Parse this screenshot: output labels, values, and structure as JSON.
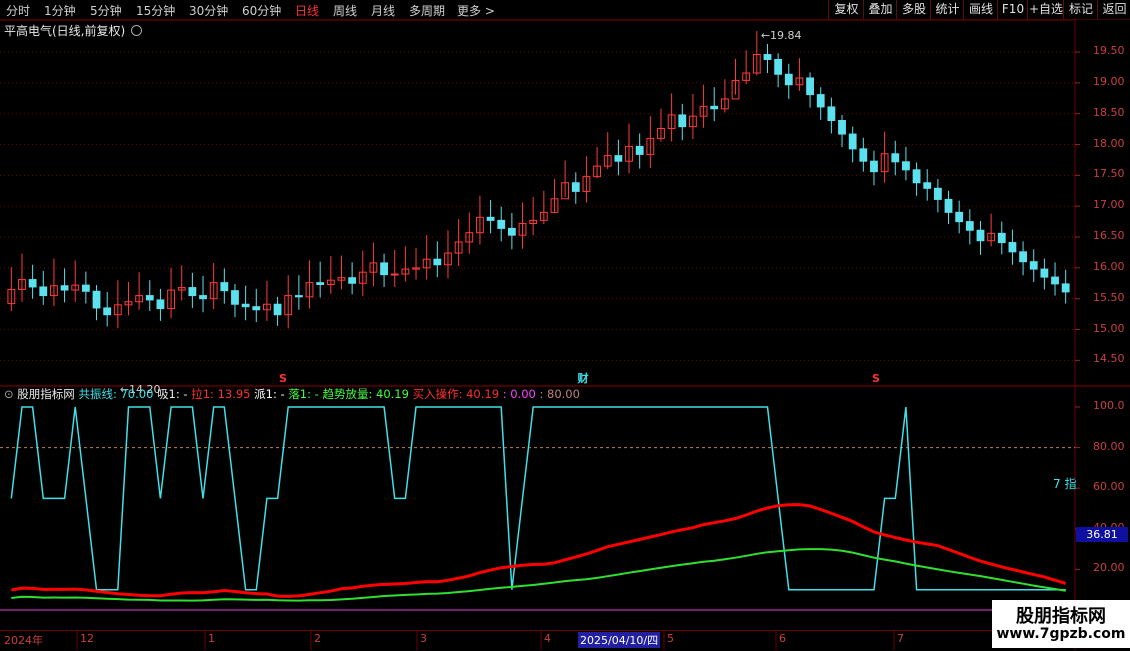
{
  "toolbar": {
    "timeframes": [
      "分时",
      "1分钟",
      "5分钟",
      "15分钟",
      "30分钟",
      "60分钟",
      "日线",
      "周线",
      "月线",
      "多周期",
      "更多 >"
    ],
    "active_timeframe": "日线",
    "right_buttons": [
      "复权",
      "叠加",
      "多股",
      "统计",
      "画线",
      "F10",
      "+自选",
      "标记",
      "返回"
    ]
  },
  "chart_title": "平高电气(日线,前复权)",
  "price_axis_labels": [
    "19.50",
    "19.00",
    "18.50",
    "18.00",
    "17.50",
    "17.00",
    "16.50",
    "16.00",
    "15.50",
    "15.00",
    "14.50"
  ],
  "price_annotations": {
    "high": "19.84",
    "low": "14.20"
  },
  "event_markers": [
    "S",
    "财",
    "S"
  ],
  "indicator": {
    "name": "股朋指标网",
    "fields": [
      {
        "text": "共振线: 70.00",
        "color": "#40e0e8"
      },
      {
        "text": "吸1: -",
        "color": "#e8e8e8"
      },
      {
        "text": "拉1: 13.95",
        "color": "#ff3030"
      },
      {
        "text": "派1: -",
        "color": "#ffffff"
      },
      {
        "text": "落1: -",
        "color": "#40ff40"
      },
      {
        "text": "趋势放量: 40.19",
        "color": "#40ff40"
      },
      {
        "text": "买入操作: 40.19",
        "color": "#ff3030"
      },
      {
        "text": ": 0.00",
        "color": "#ff40ff"
      },
      {
        "text": ": 80.00",
        "color": "#c08080"
      }
    ],
    "axis_labels": [
      "100.0",
      "80.00",
      "60.00",
      "40.00",
      "20.00"
    ],
    "current_value": "36.81",
    "side_text": "7 指"
  },
  "date_axis": [
    "2024年",
    "12",
    "1",
    "2",
    "3",
    "4",
    "2025/04/10/四",
    "5",
    "6",
    "7"
  ],
  "watermark": {
    "title": "股朋指标网",
    "url": "www.7gpzb.com"
  },
  "colors": {
    "up": "#ff3b3b",
    "down": "#5ce1ef",
    "resonance": "#40e0e8",
    "pull": "#ff0000",
    "fall": "#30e030",
    "pink": "#ff9090",
    "white": "#ffffff",
    "magenta": "#e040e0",
    "grid": "#6a0000"
  },
  "candles": [
    [
      15.42,
      15.65,
      16.01,
      15.3
    ],
    [
      15.65,
      15.81,
      16.23,
      15.45
    ],
    [
      15.81,
      15.69,
      16.05,
      15.5
    ],
    [
      15.69,
      15.55,
      15.95,
      15.4
    ],
    [
      15.55,
      15.71,
      16.15,
      15.38
    ],
    [
      15.71,
      15.64,
      15.99,
      15.44
    ],
    [
      15.64,
      15.72,
      16.12,
      15.45
    ],
    [
      15.72,
      15.62,
      15.94,
      15.42
    ],
    [
      15.62,
      15.35,
      15.72,
      15.15
    ],
    [
      15.35,
      15.24,
      15.61,
      15.05
    ],
    [
      15.24,
      15.4,
      15.8,
      15.02
    ],
    [
      15.4,
      15.45,
      15.77,
      15.23
    ],
    [
      15.45,
      15.55,
      15.93,
      15.32
    ],
    [
      15.55,
      15.48,
      15.8,
      15.3
    ],
    [
      15.48,
      15.34,
      15.66,
      15.14
    ],
    [
      15.34,
      15.64,
      16.0,
      15.18
    ],
    [
      15.64,
      15.68,
      16.04,
      15.47
    ],
    [
      15.68,
      15.55,
      15.92,
      15.35
    ],
    [
      15.55,
      15.5,
      15.87,
      15.28
    ],
    [
      15.5,
      15.76,
      16.08,
      15.33
    ],
    [
      15.76,
      15.63,
      15.99,
      15.42
    ],
    [
      15.63,
      15.41,
      15.74,
      15.2
    ],
    [
      15.41,
      15.37,
      15.71,
      15.15
    ],
    [
      15.37,
      15.32,
      15.66,
      15.12
    ],
    [
      15.32,
      15.41,
      15.79,
      15.14
    ],
    [
      15.41,
      15.24,
      15.53,
      15.06
    ],
    [
      15.24,
      15.55,
      15.88,
      15.02
    ],
    [
      15.55,
      15.53,
      15.88,
      15.32
    ],
    [
      15.53,
      15.76,
      16.12,
      15.34
    ],
    [
      15.76,
      15.73,
      16.1,
      15.52
    ],
    [
      15.73,
      15.8,
      16.19,
      15.58
    ],
    [
      15.8,
      15.84,
      16.2,
      15.65
    ],
    [
      15.84,
      15.75,
      16.09,
      15.57
    ],
    [
      15.75,
      15.93,
      16.28,
      15.54
    ],
    [
      15.93,
      16.08,
      16.41,
      15.7
    ],
    [
      16.08,
      15.89,
      16.23,
      15.69
    ],
    [
      15.89,
      15.9,
      16.29,
      15.69
    ],
    [
      15.9,
      15.98,
      16.35,
      15.78
    ],
    [
      15.98,
      16.0,
      16.32,
      15.81
    ],
    [
      16.0,
      16.14,
      16.53,
      15.81
    ],
    [
      16.14,
      16.05,
      16.43,
      15.85
    ],
    [
      16.05,
      16.24,
      16.61,
      15.83
    ],
    [
      16.24,
      16.42,
      16.79,
      16.03
    ],
    [
      16.42,
      16.57,
      16.9,
      16.23
    ],
    [
      16.57,
      16.82,
      17.17,
      16.38
    ],
    [
      16.82,
      16.77,
      17.1,
      16.56
    ],
    [
      16.77,
      16.64,
      16.99,
      16.43
    ],
    [
      16.64,
      16.53,
      16.89,
      16.3
    ],
    [
      16.53,
      16.72,
      17.06,
      16.31
    ],
    [
      16.72,
      16.77,
      17.15,
      16.53
    ],
    [
      16.77,
      16.9,
      17.25,
      16.71
    ],
    [
      16.9,
      17.12,
      17.44,
      16.91
    ],
    [
      17.12,
      17.38,
      17.74,
      17.15
    ],
    [
      17.38,
      17.24,
      17.55,
      17.04
    ],
    [
      17.24,
      17.48,
      17.81,
      17.06
    ],
    [
      17.48,
      17.65,
      17.96,
      17.45
    ],
    [
      17.65,
      17.82,
      18.2,
      17.6
    ],
    [
      17.82,
      17.73,
      18.08,
      17.5
    ],
    [
      17.73,
      17.97,
      18.34,
      17.53
    ],
    [
      17.97,
      17.84,
      18.18,
      17.61
    ],
    [
      17.84,
      18.1,
      18.46,
      17.62
    ],
    [
      18.1,
      18.26,
      18.58,
      18.05
    ],
    [
      18.26,
      18.48,
      18.83,
      18.05
    ],
    [
      18.48,
      18.29,
      18.66,
      18.07
    ],
    [
      18.29,
      18.46,
      18.82,
      18.09
    ],
    [
      18.46,
      18.62,
      18.97,
      18.27
    ],
    [
      18.62,
      18.58,
      18.93,
      18.38
    ],
    [
      18.58,
      18.74,
      19.06,
      18.52
    ],
    [
      18.74,
      19.04,
      19.39,
      18.81
    ],
    [
      19.04,
      19.16,
      19.53,
      18.98
    ],
    [
      19.16,
      19.46,
      19.84,
      19.12
    ],
    [
      19.46,
      19.38,
      19.63,
      19.16
    ],
    [
      19.38,
      19.14,
      19.48,
      18.93
    ],
    [
      19.14,
      18.97,
      19.31,
      18.74
    ],
    [
      18.97,
      19.08,
      19.4,
      18.87
    ],
    [
      19.08,
      18.81,
      19.17,
      18.6
    ],
    [
      18.81,
      18.61,
      18.93,
      18.4
    ],
    [
      18.61,
      18.39,
      18.76,
      18.18
    ],
    [
      18.39,
      18.17,
      18.48,
      17.96
    ],
    [
      18.17,
      17.93,
      18.29,
      17.71
    ],
    [
      17.93,
      17.73,
      18.11,
      17.56
    ],
    [
      17.73,
      17.56,
      17.9,
      17.34
    ],
    [
      17.56,
      17.85,
      18.21,
      17.38
    ],
    [
      17.85,
      17.72,
      18.06,
      17.5
    ],
    [
      17.72,
      17.59,
      17.96,
      17.42
    ],
    [
      17.59,
      17.38,
      17.71,
      17.17
    ],
    [
      17.38,
      17.29,
      17.6,
      17.09
    ],
    [
      17.29,
      17.11,
      17.44,
      16.9
    ],
    [
      17.11,
      16.9,
      17.25,
      16.71
    ],
    [
      16.9,
      16.75,
      17.09,
      16.56
    ],
    [
      16.75,
      16.61,
      16.95,
      16.38
    ],
    [
      16.61,
      16.44,
      16.76,
      16.21
    ],
    [
      16.44,
      16.56,
      16.88,
      16.35
    ],
    [
      16.56,
      16.41,
      16.75,
      16.22
    ],
    [
      16.41,
      16.26,
      16.62,
      16.05
    ],
    [
      16.26,
      16.1,
      16.43,
      15.88
    ],
    [
      16.1,
      15.98,
      16.3,
      15.77
    ],
    [
      15.98,
      15.85,
      16.15,
      15.65
    ],
    [
      15.85,
      15.74,
      16.09,
      15.55
    ],
    [
      15.74,
      15.61,
      15.97,
      15.42
    ]
  ]
}
